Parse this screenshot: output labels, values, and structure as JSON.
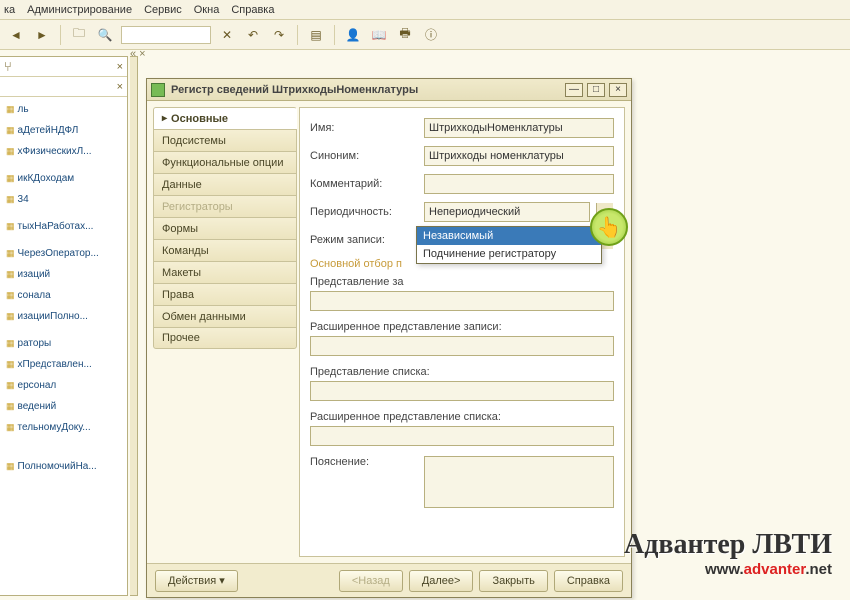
{
  "menu": {
    "items": [
      "ка",
      "Администрирование",
      "Сервис",
      "Окна",
      "Справка"
    ]
  },
  "toolbar_icons": [
    "back",
    "fwd",
    "folder",
    "search-mag",
    "x",
    "ref1",
    "ref2",
    "db",
    "man",
    "book",
    "print",
    "info"
  ],
  "tree": {
    "items": [
      "ль",
      "аДетейНДФЛ",
      "хФизическихЛ...",
      "",
      "икКДоходам",
      "34",
      "",
      "тыхНаРаботах...",
      "",
      "ЧерезОператор...",
      "изаций",
      "сонала",
      "изацииПолно...",
      "",
      "раторы",
      "хПредставлен...",
      "ерсонал",
      "ведений",
      "тельномуДоку...",
      "",
      "",
      "",
      "ПолномочийНа..."
    ]
  },
  "dialog": {
    "title": "Регистр сведений ШтрихкодыНоменклатуры",
    "tabs": [
      "Основные",
      "Подсистемы",
      "Функциональные опции",
      "Данные",
      "Регистраторы",
      "Формы",
      "Команды",
      "Макеты",
      "Права",
      "Обмен данными",
      "Прочее"
    ],
    "active_tab": 0,
    "disabled_tab": 4,
    "form": {
      "name_label": "Имя:",
      "name_value": "ШтрихкодыНоменклатуры",
      "syn_label": "Синоним:",
      "syn_value": "Штрихкоды номенклатуры",
      "comment_label": "Комментарий:",
      "comment_value": "",
      "period_label": "Периодичность:",
      "period_value": "Непериодический",
      "mode_label": "Режим записи:",
      "mode_value": "Независимый",
      "mode_options": [
        "Независимый",
        "Подчинение регистратору"
      ],
      "selection_label": "Основной отбор п",
      "rep_record_label": "Представление за",
      "rep_record_ext_label": "Расширенное представление записи:",
      "rep_list_label": "Представление списка:",
      "rep_list_ext_label": "Расширенное представление списка:",
      "explain_label": "Пояснение:"
    },
    "buttons": {
      "actions": "Действия",
      "back": "<Назад",
      "next": "Далее>",
      "close": "Закрыть",
      "help": "Справка"
    }
  },
  "watermark": {
    "line1": "Адвантер ЛВТИ",
    "line2_pre": "www.",
    "line2_mid": "advanter",
    "line2_post": ".net"
  }
}
